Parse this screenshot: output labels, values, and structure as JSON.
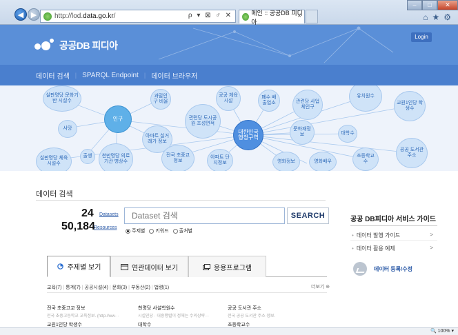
{
  "browser": {
    "url_prefix": "http://lod.",
    "url_domain": "data.go.kr",
    "url_suffix": "/",
    "address_tools": "ρ ▾ ⊠ ♂ ✕",
    "tab_title": "메인 :: 공공DB 피디아",
    "tab_close": "×",
    "zoom": "🔍 100%  ▾"
  },
  "site": {
    "brand": "공공DB 피디아",
    "login": "Login",
    "nav": [
      "데이터 검색",
      "SPARQL Endpoint",
      "데이터 브라우저"
    ]
  },
  "graph": {
    "bubbles": [
      "실판명당 문화기반 시설수",
      "인구",
      "과밀인구 비율",
      "공공 체육시설",
      "폐수 배출업소",
      "관련당 사업체인구",
      "유치원수",
      "교원1인당 학생수",
      "사망",
      "아파트 실거래가 정보",
      "관련당 도시공원 조성면적",
      "대한민국 행정구역",
      "문화재정보",
      "대학수",
      "출생",
      "천만명당 의료기관 병상수",
      "전국 초중교 정보",
      "아파트 단지정보",
      "초등학교수",
      "공공 도서관 주소",
      "실판명당 체육시설수",
      "영화정보",
      "영화배우"
    ]
  },
  "search": {
    "section_title": "데이터 검색",
    "datasets_count": "24",
    "datasets_label": "Datasets",
    "resources_count": "50,184",
    "resources_label": "Resources",
    "placeholder": "Dataset 검색",
    "button": "SEARCH",
    "radios": [
      {
        "label": "주제별",
        "selected": true
      },
      {
        "label": "키워드",
        "selected": false
      },
      {
        "label": "출처별",
        "selected": false
      }
    ]
  },
  "guide": {
    "title": "공공 DB피디아 서비스 가이드",
    "items": [
      {
        "label": "데이터 발행 가이드",
        "arrow": ">"
      },
      {
        "label": "데이터 활용 예제",
        "arrow": ">"
      }
    ],
    "register": "데이터 등록/수정"
  },
  "tabs": [
    {
      "label": "주제별 보기",
      "icon": "globe-icon"
    },
    {
      "label": "연관데이터 보기",
      "icon": "window-icon"
    },
    {
      "label": "응용프로그램",
      "icon": "app-icon"
    }
  ],
  "categories": [
    "교육(7)",
    "통계(7)",
    "공공시설(4)",
    "문화(3)",
    "부동산(2)",
    "법령(1)"
  ],
  "more": "더보기",
  "items": [
    {
      "title": "전국 초중고교 정보",
      "desc": "전국 초중고등학교 교육정보. (http://ww···"
    },
    {
      "title": "천명당 사설학원수",
      "desc": "시설인당 · 대중행렬이 정해는 수의상략···"
    },
    {
      "title": "공공 도서관 주소",
      "desc": "전국 공공 도서관 주소 정보."
    },
    {
      "title": "교원1인당 학생수",
      "desc": ""
    },
    {
      "title": "대학수",
      "desc": ""
    },
    {
      "title": "초등학교수",
      "desc": ""
    }
  ],
  "colors": {
    "header": "#5a8fd8",
    "nav": "#4a7fce",
    "accent": "#2b5aa7"
  }
}
